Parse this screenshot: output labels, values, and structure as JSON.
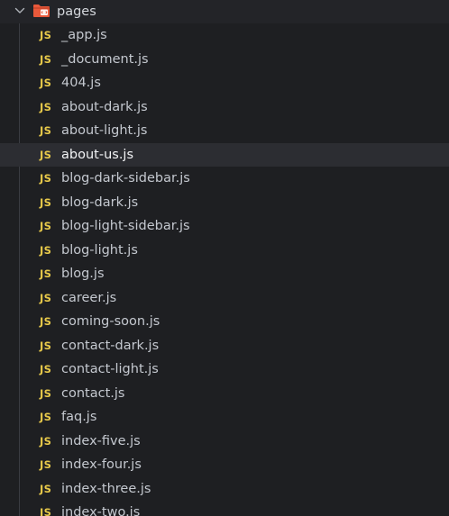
{
  "folder": {
    "name": "pages",
    "expanded": true,
    "chevron_icon": "chevron-down-icon",
    "folder_icon": "pages-folder-icon",
    "folder_icon_color": "#e8593b"
  },
  "files": [
    {
      "badge": "JS",
      "name": "_app.js"
    },
    {
      "badge": "JS",
      "name": "_document.js"
    },
    {
      "badge": "JS",
      "name": "404.js"
    },
    {
      "badge": "JS",
      "name": "about-dark.js"
    },
    {
      "badge": "JS",
      "name": "about-light.js"
    },
    {
      "badge": "JS",
      "name": "about-us.js"
    },
    {
      "badge": "JS",
      "name": "blog-dark-sidebar.js"
    },
    {
      "badge": "JS",
      "name": "blog-dark.js"
    },
    {
      "badge": "JS",
      "name": "blog-light-sidebar.js"
    },
    {
      "badge": "JS",
      "name": "blog-light.js"
    },
    {
      "badge": "JS",
      "name": "blog.js"
    },
    {
      "badge": "JS",
      "name": "career.js"
    },
    {
      "badge": "JS",
      "name": "coming-soon.js"
    },
    {
      "badge": "JS",
      "name": "contact-dark.js"
    },
    {
      "badge": "JS",
      "name": "contact-light.js"
    },
    {
      "badge": "JS",
      "name": "contact.js"
    },
    {
      "badge": "JS",
      "name": "faq.js"
    },
    {
      "badge": "JS",
      "name": "index-five.js"
    },
    {
      "badge": "JS",
      "name": "index-four.js"
    },
    {
      "badge": "JS",
      "name": "index-three.js"
    },
    {
      "badge": "JS",
      "name": "index-two.js"
    }
  ],
  "selected_file": "about-us.js",
  "colors": {
    "background": "#1e1f22",
    "selected_row": "#2c2d32",
    "js_badge": "#e6c84a",
    "text": "#c4c8cf"
  }
}
